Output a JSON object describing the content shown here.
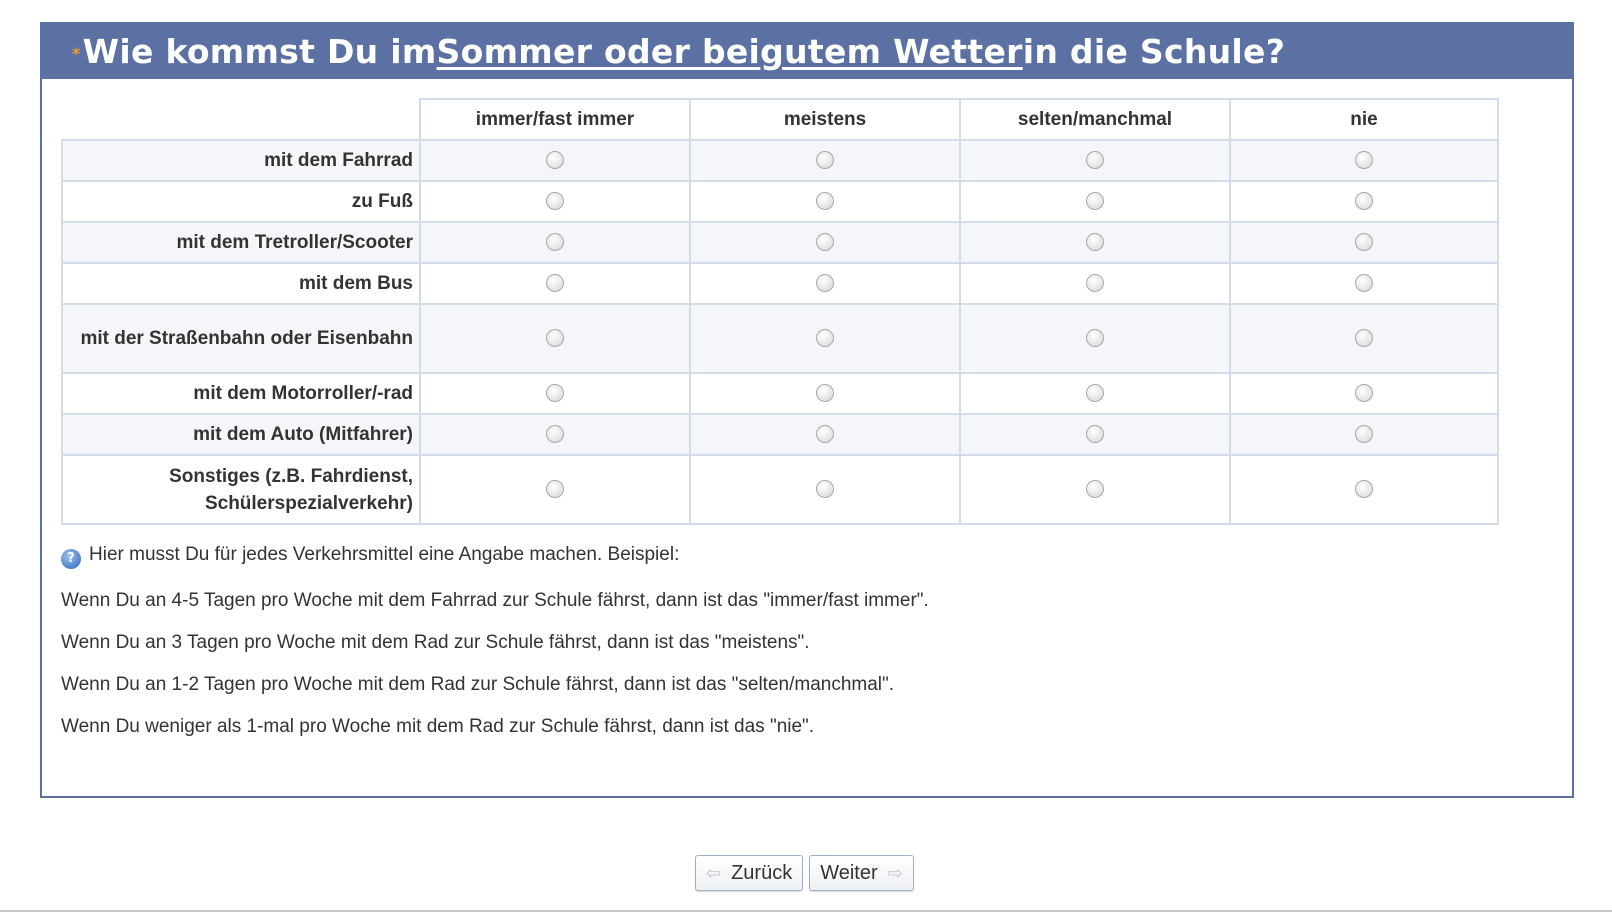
{
  "question": {
    "required_marker": "*",
    "title_parts": {
      "lead": "Wie kommst Du im ",
      "underlined_1": "Sommer oder bei ",
      "underlined_2": "gutem Wetter",
      "tail": " in die Schule?"
    }
  },
  "matrix": {
    "columns": [
      "immer/fast immer",
      "meistens",
      "selten/manchmal",
      "nie"
    ],
    "rows": [
      "mit dem Fahrrad",
      "zu Fuß",
      "mit dem Tretroller/Scooter",
      "mit dem Bus",
      "mit der Straßenbahn oder Eisenbahn",
      "mit dem Motorroller/-rad",
      "mit dem Auto (Mitfahrer)",
      "Sonstiges (z.B. Fahrdienst, Schülerspezialverkehr)"
    ]
  },
  "help": {
    "icon": "help-icon",
    "lines": [
      "Hier musst Du für jedes Verkehrsmittel eine Angabe machen. Beispiel:",
      "Wenn Du an 4-5 Tagen pro Woche mit dem Fahrrad zur Schule fährst, dann ist das \"immer/fast immer\".",
      "Wenn Du an 3 Tagen pro Woche mit dem Rad zur Schule fährst, dann ist das \"meistens\".",
      "Wenn Du an 1-2 Tagen pro Woche mit dem Rad zur Schule fährst, dann ist das \"selten/manchmal\".",
      "Wenn Du weniger als 1-mal pro Woche mit dem Rad zur Schule fährst, dann ist das \"nie\"."
    ]
  },
  "nav": {
    "back_label": "Zurück",
    "next_label": "Weiter"
  },
  "colors": {
    "header_bg": "#5b71a3",
    "required_marker": "#f0a030",
    "table_border": "#d3dde9"
  }
}
